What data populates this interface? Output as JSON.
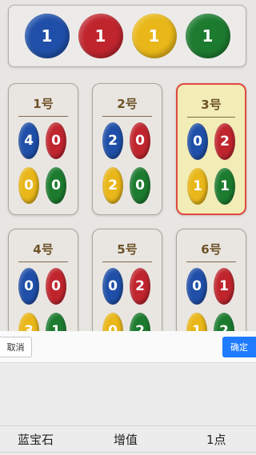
{
  "colors": {
    "blue": "#1f4fa8",
    "red": "#c0252e",
    "yellow": "#e9b719",
    "green": "#1c7b2f",
    "confirm": "#1f7bff"
  },
  "pool": {
    "coins": [
      {
        "color": "blue",
        "value": "1"
      },
      {
        "color": "red",
        "value": "1"
      },
      {
        "color": "yellow",
        "value": "1"
      },
      {
        "color": "green",
        "value": "1"
      }
    ]
  },
  "cards": [
    {
      "title": "1号",
      "selected": false,
      "blue": "4",
      "red": "0",
      "yellow": "0",
      "green": "0"
    },
    {
      "title": "2号",
      "selected": false,
      "blue": "2",
      "red": "0",
      "yellow": "2",
      "green": "0"
    },
    {
      "title": "3号",
      "selected": true,
      "blue": "0",
      "red": "2",
      "yellow": "1",
      "green": "1"
    },
    {
      "title": "4号",
      "selected": false,
      "blue": "0",
      "red": "0",
      "yellow": "3",
      "green": "1"
    },
    {
      "title": "5号",
      "selected": false,
      "blue": "0",
      "red": "2",
      "yellow": "0",
      "green": "2"
    },
    {
      "title": "6号",
      "selected": false,
      "blue": "0",
      "red": "1",
      "yellow": "1",
      "green": "2"
    }
  ],
  "picker": {
    "cancel_label": "取消",
    "confirm_label": "确定",
    "selected_row": {
      "item": "蓝宝石",
      "action": "增值",
      "amount": "1点"
    }
  }
}
